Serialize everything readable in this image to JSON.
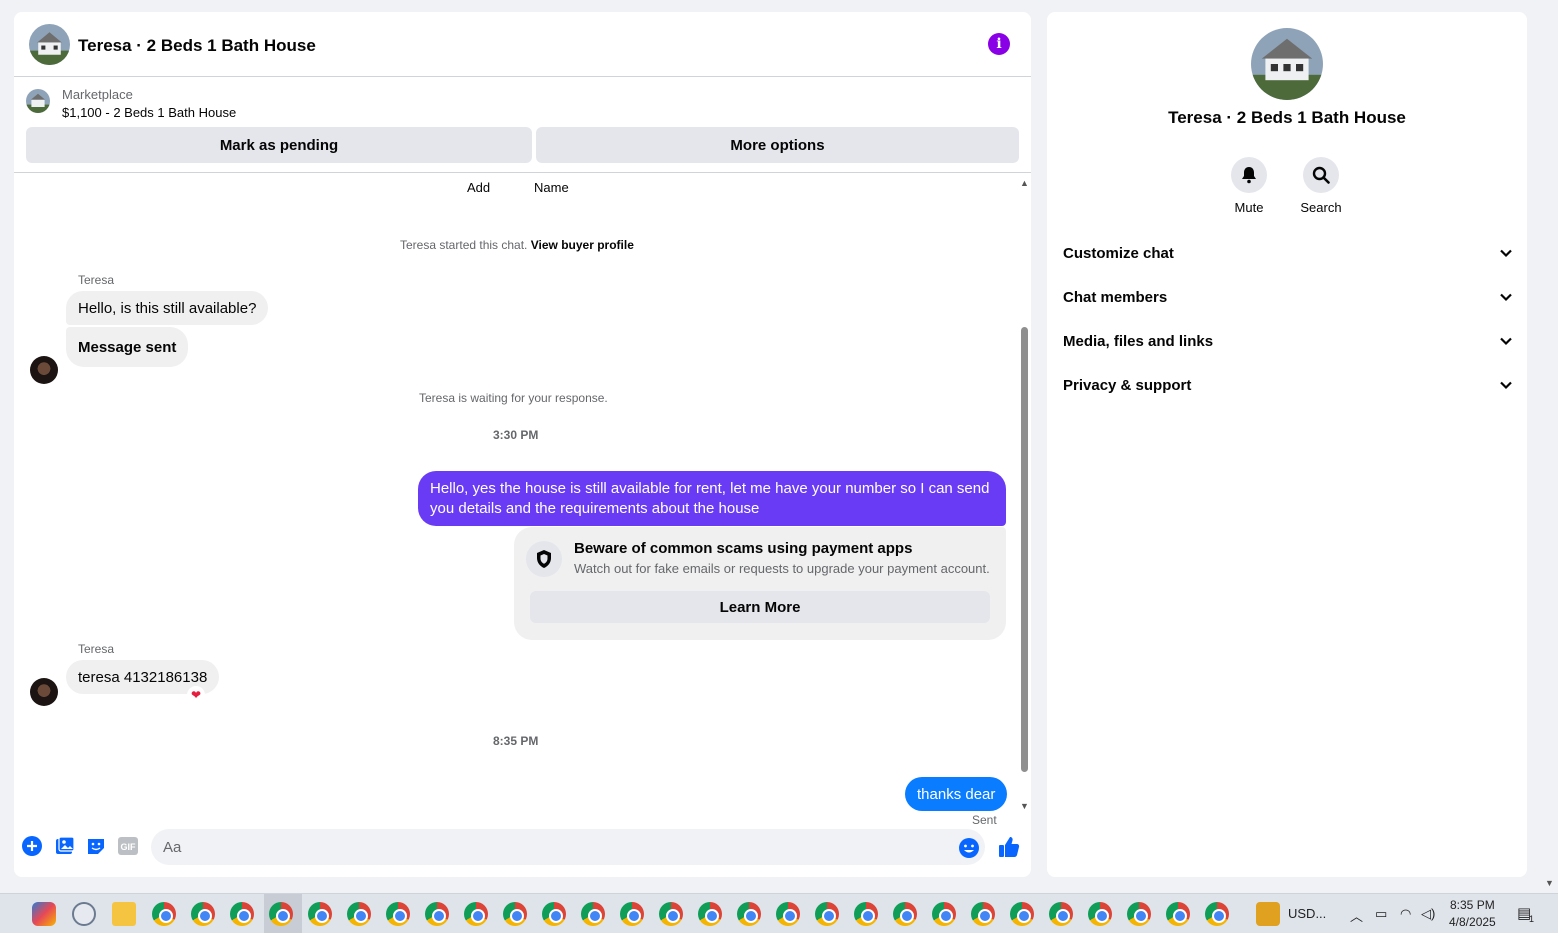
{
  "chat": {
    "title": "Teresa · 2 Beds 1 Bath House",
    "info_icon": "info-icon",
    "marketplace": {
      "label": "Marketplace",
      "listing": "$1,100 - 2 Beds 1 Bath House",
      "mark_pending_label": "Mark as pending",
      "more_options_label": "More options"
    },
    "top_labels": {
      "add": "Add",
      "name": "Name"
    },
    "start_notice": "Teresa started this chat.",
    "view_profile_link": "View buyer profile",
    "waiting_notice": "Teresa is waiting for your response.",
    "messages": {
      "m1_sender": "Teresa",
      "m1_text": "Hello, is this still available?",
      "m2_text": "Message sent",
      "time1": "3:30 PM",
      "m3_text": "Hello, yes the house is still available for rent, let me have your number so I can send you details and the requirements about the house",
      "scam_title": "Beware of common scams using payment apps",
      "scam_desc": "Watch out for fake emails or requests to upgrade your payment account.",
      "learn_more": "Learn More",
      "m4_sender": "Teresa",
      "m4_text": "teresa 4132186138",
      "m4_reaction": "❤",
      "time2": "8:35 PM",
      "m5_text": "thanks dear",
      "m5_status": "Sent"
    },
    "composer": {
      "placeholder": "Aa",
      "gif_label": "GIF"
    }
  },
  "sidebar": {
    "title": "Teresa · 2 Beds 1 Bath House",
    "mute_label": "Mute",
    "search_label": "Search",
    "sections": [
      "Customize chat",
      "Chat members",
      "Media, files and links",
      "Privacy & support"
    ]
  },
  "taskbar": {
    "currency": "USD...",
    "time": "8:35 PM",
    "date": "4/8/2025",
    "notif_count": "1"
  },
  "colors": {
    "outgoing_bubble": "#6a3bf5",
    "outgoing_bubble_latest": "#0a7cff",
    "info_accent": "#8a00e6",
    "link_blue": "#0866ff"
  }
}
